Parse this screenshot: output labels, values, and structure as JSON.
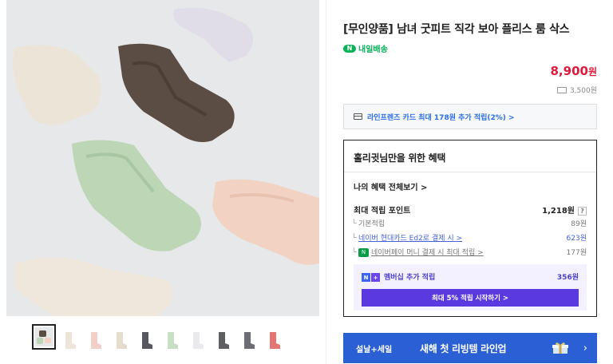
{
  "product": {
    "title": "[무인양품] 남녀 굿피트 직각 보아 플리스 룸 삭스",
    "delivery_label": "내일배송",
    "delivery_badge": "N",
    "price_value": "8,900",
    "price_unit": "원",
    "shipping_fee": "3,500원"
  },
  "card_promo": {
    "text": "라인프렌즈 카드 최대 178원 추가 적립(2%) >"
  },
  "benefit": {
    "title": "홀리귓님만을 위한 혜택",
    "view_all": "나의 혜택 전체보기 >",
    "max_points_label": "최대 적립 포인트",
    "max_points_value": "1,218원",
    "help_icon_text": "?",
    "rows": [
      {
        "label": "기본적립",
        "value": "89원"
      },
      {
        "label": "네이버 현대카드 Ed2로 결제 시 >",
        "value": "623원"
      },
      {
        "label": "네이버페이 머니 결제 시 최대 적립 >",
        "value": "177원"
      }
    ],
    "membership_label": "멤버십 추가 적립",
    "membership_value": "356원",
    "membership_badge": [
      "N",
      "+"
    ],
    "membership_button": "최대 5% 적립 시작하기 >"
  },
  "banner": {
    "tag": "설날+세일",
    "text": "새해 첫 리빙템 라인업",
    "arrow": "›"
  },
  "thumbnails": [
    "multi",
    "cream",
    "pink",
    "beige",
    "charcoal",
    "mint",
    "white",
    "dark-gray",
    "gray",
    "red"
  ],
  "colors": {
    "price": "#e0193a",
    "delivery": "#07b259",
    "link": "#4662d6",
    "membership": "#5a3ae0",
    "banner": "#2a60d4"
  }
}
